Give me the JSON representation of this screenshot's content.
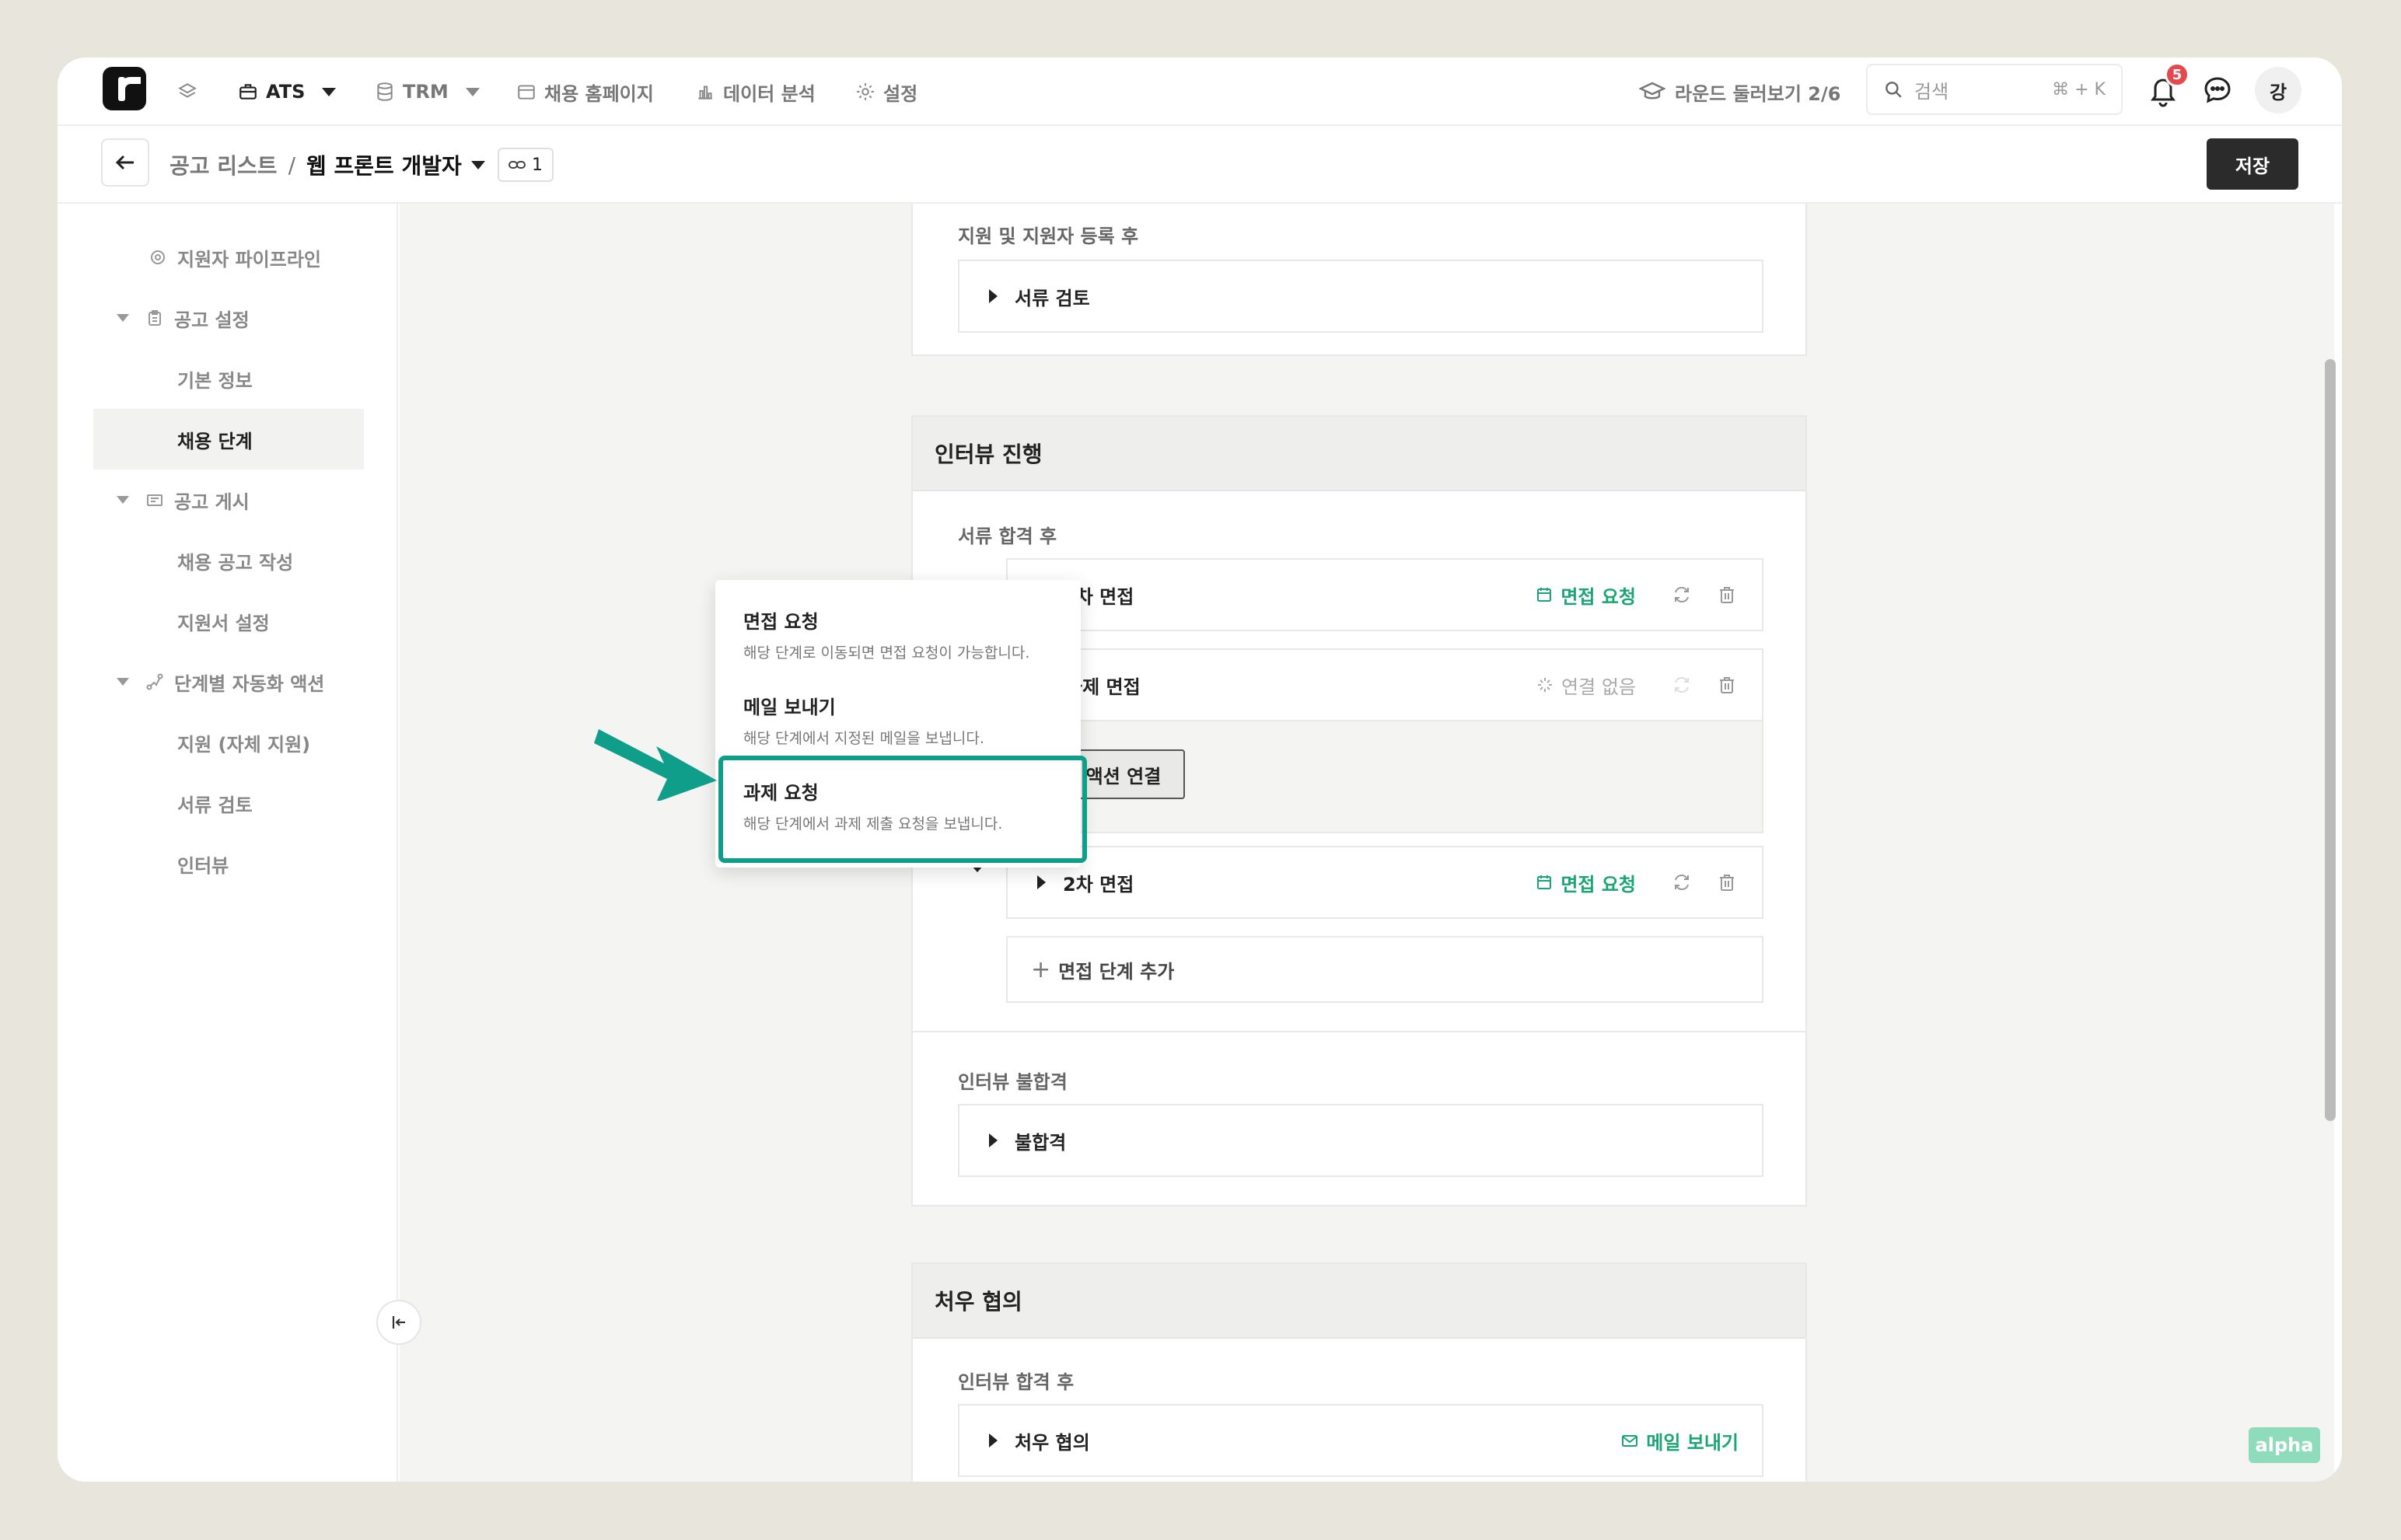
{
  "nav": {
    "items": [
      {
        "label": "ATS",
        "icon": "briefcase-icon"
      },
      {
        "label": "TRM",
        "icon": "database-icon"
      },
      {
        "label": "채용 홈페이지",
        "icon": "browser-icon"
      },
      {
        "label": "데이터 분석",
        "icon": "bar-chart-icon"
      },
      {
        "label": "설정",
        "icon": "gear-icon"
      }
    ],
    "round_label": "라운드 둘러보기 2/6",
    "search_placeholder": "검색",
    "search_shortcut": "⌘ + K",
    "notification_count": "5",
    "avatar_initial": "강"
  },
  "subheader": {
    "breadcrumb_parent": "공고 리스트",
    "breadcrumb_sep": "/",
    "breadcrumb_current": "웹 프론트 개발자",
    "link_count": "1",
    "save_label": "저장"
  },
  "sidebar": {
    "items": [
      {
        "label": "지원자 파이프라인",
        "level": "top",
        "icon": "target-icon"
      },
      {
        "label": "공고 설정",
        "level": "section",
        "icon": "clipboard-icon"
      },
      {
        "label": "기본 정보",
        "level": "child"
      },
      {
        "label": "채용 단계",
        "level": "child",
        "active": true
      },
      {
        "label": "공고 게시",
        "level": "section",
        "icon": "board-icon"
      },
      {
        "label": "채용 공고 작성",
        "level": "child"
      },
      {
        "label": "지원서 설정",
        "level": "child"
      },
      {
        "label": "단계별 자동화 액션",
        "level": "section",
        "icon": "flow-icon"
      },
      {
        "label": "지원 (자체 지원)",
        "level": "child"
      },
      {
        "label": "서류 검토",
        "level": "child"
      },
      {
        "label": "인터뷰",
        "level": "child"
      }
    ]
  },
  "main": {
    "card1": {
      "group_label": "지원 및 지원자 등록 후",
      "stage": "서류 검토"
    },
    "card2": {
      "title": "인터뷰 진행",
      "group_label": "서류 합격 후",
      "stages": [
        {
          "name": "1차 면접",
          "action": "면접 요청"
        },
        {
          "name": "과제 면접",
          "action": "연결 없음"
        },
        {
          "name": "2차 면접",
          "action": "면접 요청"
        }
      ],
      "connect_action_label": "액션 연결",
      "add_stage_label": "면접 단계 추가",
      "fail_group_label": "인터뷰 불합격",
      "fail_stage": "불합격"
    },
    "card3": {
      "title": "처우 협의",
      "group_label": "인터뷰 합격 후",
      "stage": "처우 협의",
      "action": "메일 보내기"
    }
  },
  "dropdown": {
    "items": [
      {
        "title": "면접 요청",
        "desc": "해당 단계로 이동되면 면접 요청이 가능합니다."
      },
      {
        "title": "메일 보내기",
        "desc": "해당 단계에서 지정된 메일을 보냅니다."
      },
      {
        "title": "과제 요청",
        "desc": "해당 단계에서 과제 제출 요청을 보냅니다."
      }
    ],
    "highlighted_index": 2
  },
  "alpha_badge": "alpha",
  "colors": {
    "accent_green": "#1aa672",
    "highlight_teal": "#0e9e8a",
    "badge_red": "#e5484d",
    "save_button": "#2b2b2b"
  }
}
